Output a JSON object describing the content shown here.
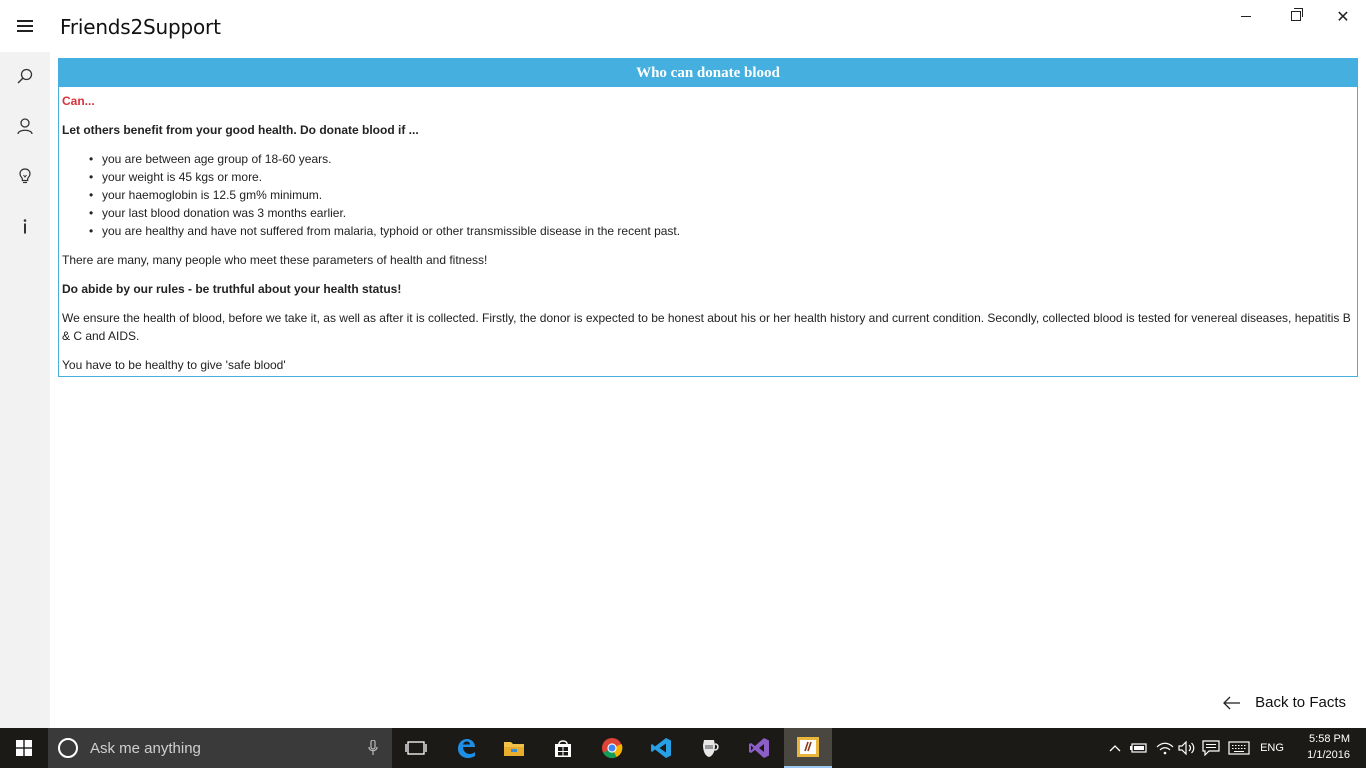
{
  "app": {
    "title": "Friends2Support"
  },
  "card": {
    "header": "Who can donate blood",
    "can_label": "Can...",
    "lead": "Let others benefit from your good health. Do donate blood if ...",
    "criteria": [
      "you are between age group of 18-60 years.",
      "your weight is 45 kgs or more.",
      "your haemoglobin is 12.5 gm% minimum.",
      "your last blood donation was 3 months earlier.",
      "you are healthy and have not suffered from malaria, typhoid or other transmissible disease in the recent past."
    ],
    "note": "There are many, many people who meet these parameters of health and fitness!",
    "rules_heading": "Do abide by our rules - be truthful about your health status!",
    "ensure_text": "We ensure the health of blood, before we take it, as well as after it is collected. Firstly, the donor is expected to be honest about his or her health history and current condition. Secondly, collected blood is tested for venereal diseases, hepatitis B & C and AIDS.",
    "closing": "You have to be healthy to give 'safe blood'"
  },
  "back_link": {
    "label": "Back to Facts"
  },
  "taskbar": {
    "search_placeholder": "Ask me anything",
    "language": "ENG",
    "time": "5:58 PM",
    "date": "1/1/2016"
  },
  "colors": {
    "accent": "#45b0e0",
    "can_red": "#d8333c",
    "rail_bg": "#f2f2f2",
    "taskbar_bg": "#1c1a17"
  },
  "icons": {
    "rail": [
      "search-icon",
      "person-icon",
      "lightbulb-icon",
      "info-icon"
    ],
    "taskbar": [
      "task-view-icon",
      "edge-icon",
      "file-explorer-icon",
      "store-icon",
      "chrome-icon",
      "vs-code-icon",
      "jug-app-icon",
      "visual-studio-icon",
      "friends2support-app-icon"
    ]
  }
}
